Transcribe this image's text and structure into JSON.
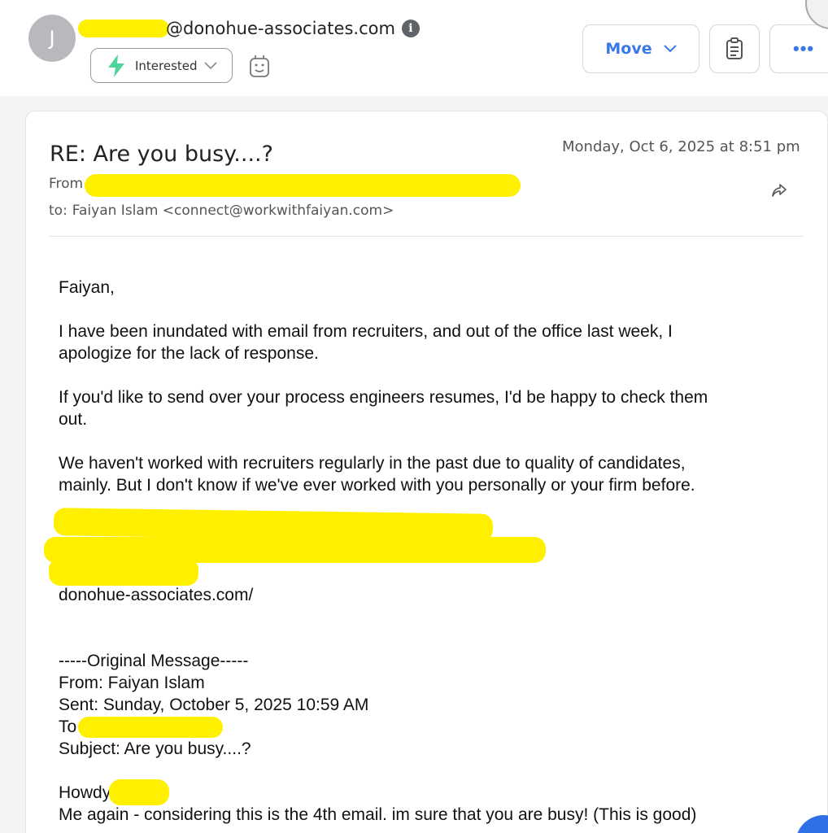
{
  "header": {
    "avatar_initial": "J",
    "sender_domain": "@donohue-associates.com",
    "info_icon": "info-icon",
    "status_label": "Interested",
    "status_icon": "lightning-bolt-icon",
    "robot_icon": "robot-icon",
    "move_label": "Move",
    "notes_icon": "clipboard-icon",
    "more_label": "•••",
    "colors": {
      "accent": "#3a78e8",
      "bolt": "#4fd49a",
      "redaction": "#fff000"
    }
  },
  "email": {
    "subject": "RE: Are you busy....?",
    "date": "Monday, Oct 6, 2025 at 8:51 pm",
    "from_label": "From",
    "to_label": "to:",
    "to_value": "Faiyan Islam <connect@workwithfaiyan.com>",
    "forward_icon": "forward-icon"
  },
  "body": {
    "greeting": "Faiyan,",
    "p1_line1": "I have been inundated with email from recruiters, and out of the office last week, I",
    "p1_line2": "apologize for the lack of response.",
    "p2_line1": "If you'd like to send over your process engineers resumes, I'd be happy to check them",
    "p2_line2": "out.",
    "p3_line1": "We haven't worked with recruiters regularly in the past due to quality of candidates,",
    "p3_line2": "mainly. But I don't know if we've ever worked with you personally or your firm before.",
    "signature_url": "donohue-associates.com/",
    "orig_header": "-----Original Message-----",
    "orig_from": "From: Faiyan Islam",
    "orig_sent": "Sent: Sunday, October 5, 2025 10:59 AM",
    "orig_to": "To",
    "orig_subject": "Subject: Are you busy....?",
    "orig_greeting": "Howdy",
    "orig_line": "Me again - considering this is the 4th email. im sure that you are busy! (This is good)"
  }
}
